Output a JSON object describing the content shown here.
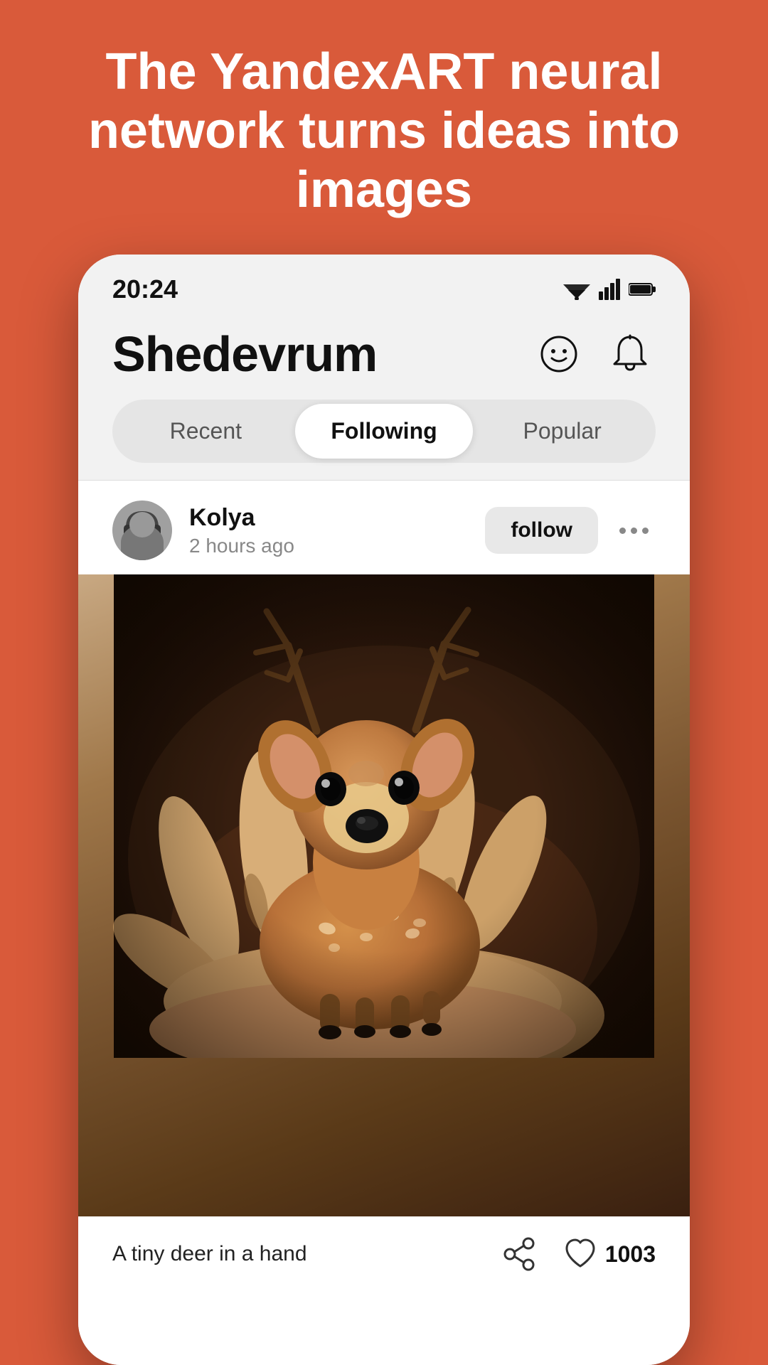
{
  "page": {
    "background_color": "#D95A3A"
  },
  "headline": {
    "text": "The YandexART neural network turns ideas into images"
  },
  "status_bar": {
    "time": "20:24"
  },
  "app": {
    "title": "Shedevrum"
  },
  "header_icons": {
    "profile_icon": "smiley-face-icon",
    "notification_icon": "bell-icon"
  },
  "tabs": {
    "items": [
      {
        "label": "Recent",
        "active": false
      },
      {
        "label": "Following",
        "active": true
      },
      {
        "label": "Popular",
        "active": false
      }
    ]
  },
  "post": {
    "username": "Kolya",
    "time_ago": "2 hours ago",
    "follow_label": "follow",
    "caption": "A tiny deer in a hand",
    "like_count": "1003"
  },
  "footer": {
    "share_icon": "share-icon",
    "like_icon": "heart-icon"
  }
}
